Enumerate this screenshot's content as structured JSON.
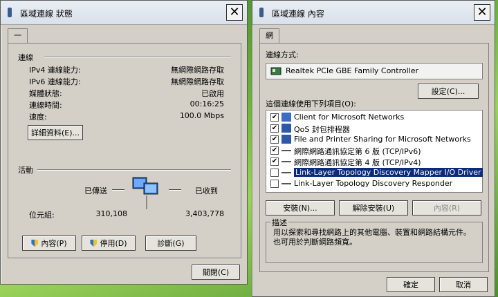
{
  "status_window": {
    "title": "區域連線 狀態",
    "tab": "一般",
    "connection_heading": "連線",
    "rows": [
      {
        "label": "IPv4 連線能力:",
        "value": "無網際網路存取"
      },
      {
        "label": "IPv6 連線能力:",
        "value": "無網際網路存取"
      },
      {
        "label": "媒體狀態:",
        "value": "已啟用"
      },
      {
        "label": "連線時間:",
        "value": "00:16:25"
      },
      {
        "label": "速度:",
        "value": "100.0 Mbps"
      }
    ],
    "details_button": "詳細資料(E)...",
    "activity_heading": "活動",
    "sent_label": "已傳送",
    "received_label": "已收到",
    "bytes_label": "位元組:",
    "bytes_sent": "310,108",
    "bytes_received": "3,403,778",
    "properties_button": "內容(P)",
    "disable_button": "停用(D)",
    "diagnose_button": "診斷(G)",
    "close_button": "關閉(C)"
  },
  "properties_window": {
    "title": "區域連線 內容",
    "tab": "網路功能",
    "connect_using_label": "連線方式:",
    "adapter_name": "Realtek PCIe GBE Family Controller",
    "configure_button": "設定(C)...",
    "items_label": "這個連線使用下列項目(O):",
    "items": [
      {
        "label": "Client for Microsoft Networks",
        "checked": true,
        "icon": "network-client-icon"
      },
      {
        "label": "QoS 封包排程器",
        "checked": true,
        "icon": "network-service-icon"
      },
      {
        "label": "File and Printer Sharing for Microsoft Networks",
        "checked": true,
        "icon": "network-service-icon"
      },
      {
        "label": "網際網路通訊協定第 6 版 (TCP/IPv6)",
        "checked": true,
        "icon": "protocol-icon"
      },
      {
        "label": "網際網路通訊協定第 4 版 (TCP/IPv4)",
        "checked": true,
        "icon": "protocol-icon"
      },
      {
        "label": "Link-Layer Topology Discovery Mapper I/O Driver",
        "checked": false,
        "icon": "protocol-icon",
        "selected": true
      },
      {
        "label": "Link-Layer Topology Discovery Responder",
        "checked": false,
        "icon": "protocol-icon"
      }
    ],
    "install_button": "安裝(N)...",
    "uninstall_button": "解除安裝(U)",
    "properties_button": "內容(R)",
    "description_heading": "描述",
    "description_text": "用以探索和尋找網路上的其他電腦、裝置和網路結構元件。也可用於判斷網路頻寬。",
    "ok_button": "確定",
    "cancel_button": "取消"
  },
  "colors": {
    "selection": "#0b2a7a",
    "dialog_bg": "#d4d0c8"
  }
}
